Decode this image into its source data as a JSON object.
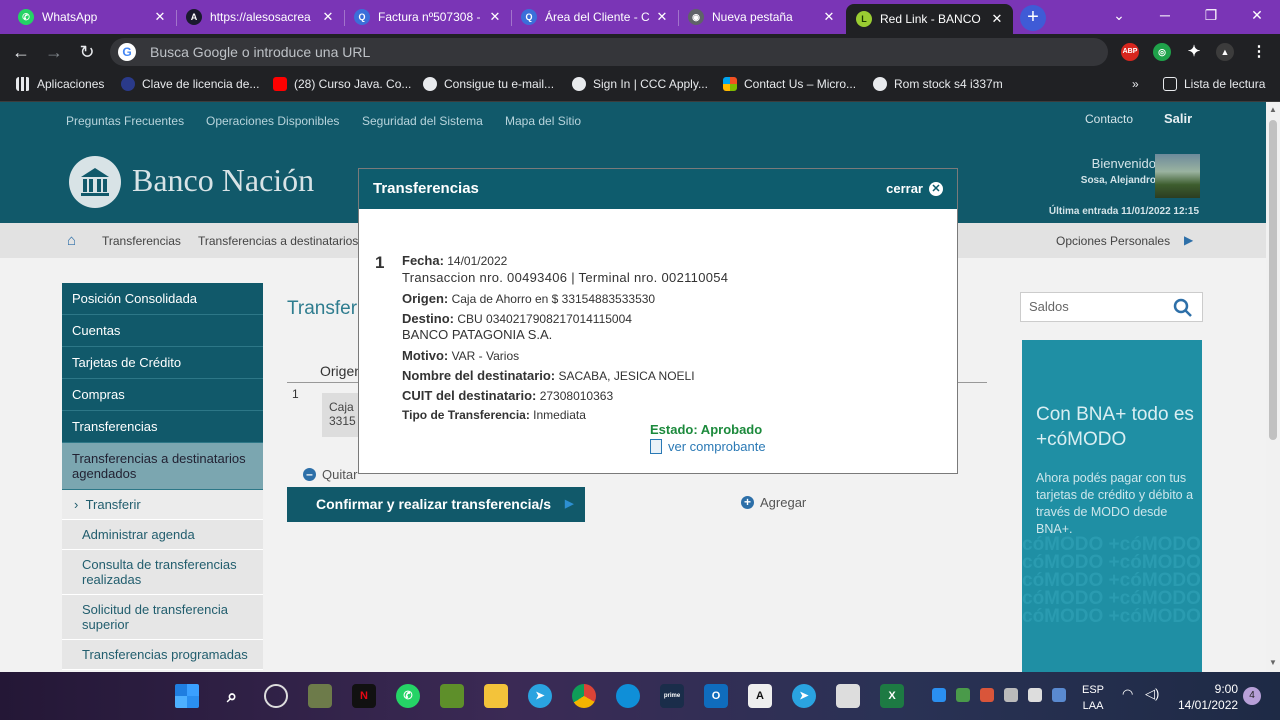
{
  "browser": {
    "tabs": [
      {
        "title": "WhatsApp",
        "color": "#25d366",
        "icon": "whatsapp-icon"
      },
      {
        "title": "https://alesosacrea",
        "color": "#1a1a2e",
        "icon": "a-icon"
      },
      {
        "title": "Factura nº507308 -",
        "color": "#3b6fd9",
        "icon": "search-icon"
      },
      {
        "title": "Área del Cliente - C",
        "color": "#3b6fd9",
        "icon": "search-icon"
      },
      {
        "title": "Nueva pestaña",
        "color": "#5f6368",
        "icon": "chrome-icon"
      },
      {
        "title": "Red Link - BANCO",
        "color": "#9acd32",
        "icon": "link-icon"
      }
    ],
    "tab_close": "✕",
    "new_tab": "+",
    "omnibox_placeholder": "Busca Google o introduce una URL",
    "bookmarks": [
      {
        "label": "Aplicaciones",
        "icon": "apps-grid-icon"
      },
      {
        "label": "Clave de licencia de...",
        "icon": "key-icon"
      },
      {
        "label": "(28) Curso Java. Co...",
        "icon": "youtube-icon"
      },
      {
        "label": "Consigue tu e-mail...",
        "icon": "globe-icon"
      },
      {
        "label": "Sign In | CCC Apply...",
        "icon": "globe-icon"
      },
      {
        "label": "Contact Us – Micro...",
        "icon": "microsoft-icon"
      },
      {
        "label": "Rom stock s4 i337m",
        "icon": "globe-icon"
      }
    ],
    "reading_list": "Lista de lectura",
    "ext_abp": "ABP"
  },
  "header": {
    "links": [
      "Preguntas Frecuentes",
      "Operaciones Disponibles",
      "Seguridad del Sistema",
      "Mapa del Sitio"
    ],
    "contacto": "Contacto",
    "salir": "Salir",
    "brand": "Banco Nación",
    "welcome": "Bienvenido",
    "user_name": "Sosa, Alejandro",
    "last_entry": "Última entrada 11/01/2022 12:15"
  },
  "breadcrumb": {
    "items": [
      "Transferencias",
      "Transferencias a destinatarios"
    ],
    "personal_options": "Opciones Personales"
  },
  "sidemenu": {
    "items": [
      "Posición Consolidada",
      "Cuentas",
      "Tarjetas de Crédito",
      "Compras",
      "Transferencias"
    ],
    "active": "Transferencias a destinatarios agendados",
    "subitems": [
      "Transferir",
      "Administrar agenda",
      "Consulta de transferencias realizadas",
      "Solicitud de transferencia superior",
      "Transferencias programadas"
    ]
  },
  "main": {
    "title": "Transfer",
    "col_origen": "Origen",
    "row_num": "1",
    "caja_text": "Caja 3315",
    "quitar": "Quitar",
    "confirm_button": "Confirmar y realizar transferencia/s",
    "agregar": "Agregar"
  },
  "right": {
    "search_placeholder": "Saldos",
    "ad_title": "Con BNA+ todo es +cóMODO",
    "ad_body": "Ahora podés pagar con tus tarjetas de crédito y débito a través de MODO desde BNA+.",
    "ad_ghost": "cóMODO +cóMODO"
  },
  "modal": {
    "title": "Transferencias",
    "close_label": "cerrar",
    "entry_number": "1",
    "fecha_label": "Fecha:",
    "fecha": "14/01/2022",
    "transaccion": "Transaccion nro. 00493406 | Terminal nro. 002110054",
    "origen_label": "Origen:",
    "origen": "Caja de Ahorro en $ 33154883533530",
    "destino_label": "Destino:",
    "destino": "CBU 0340217908217014115004",
    "banco": "BANCO PATAGONIA S.A.",
    "motivo_label": "Motivo:",
    "motivo": "VAR - Varios",
    "nombre_label": "Nombre del destinatario:",
    "nombre": "SACABA, JESICA NOELI",
    "cuit_label": "CUIT del destinatario:",
    "cuit": "27308010363",
    "tipo_label": "Tipo de Transferencia:",
    "tipo": "Inmediata",
    "estado": "Estado: Aprobado",
    "ver_comprobante": "ver comprobante"
  },
  "taskbar": {
    "lang_line1": "ESP",
    "lang_line2": "LAA",
    "time": "9:00",
    "date": "14/01/2022",
    "notifications": "4"
  }
}
